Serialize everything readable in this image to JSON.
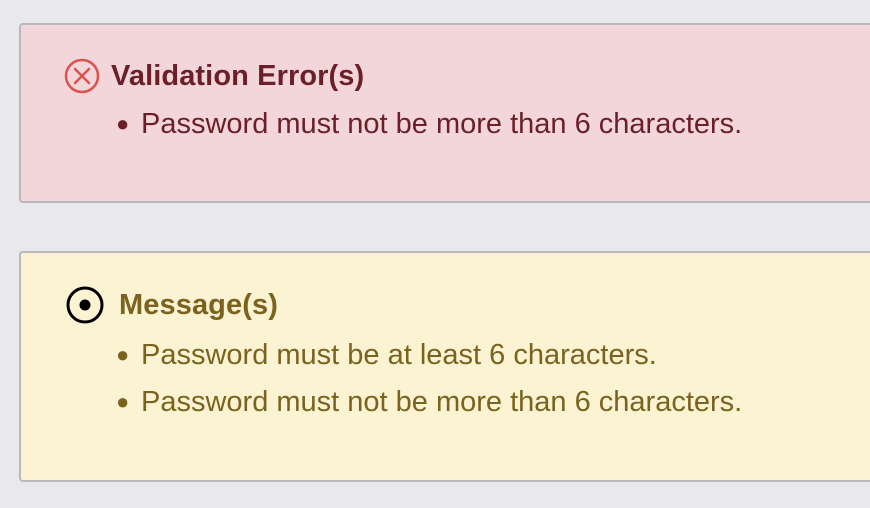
{
  "error_panel": {
    "icon": "circle-x-icon",
    "title": "Validation Error(s)",
    "items": [
      "Password must not be more than 6 characters."
    ],
    "colors": {
      "background": "#f3d6d9",
      "text": "#6b1f28",
      "icon": "#d9534f"
    }
  },
  "message_panel": {
    "icon": "circle-dot-icon",
    "title": "Message(s)",
    "items": [
      "Password must be at least 6 characters.",
      "Password must not be more than 6 characters."
    ],
    "colors": {
      "background": "#fbf3d1",
      "text": "#7b621f",
      "icon": "#000000"
    }
  }
}
